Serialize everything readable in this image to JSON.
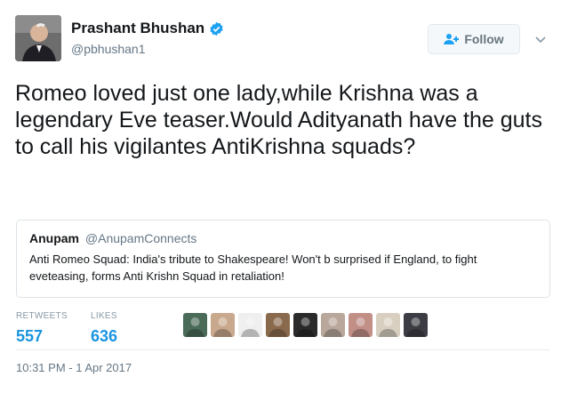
{
  "author": {
    "display_name": "Prashant Bhushan",
    "handle": "@pbhushan1",
    "verified": true,
    "avatar_icon": "user-avatar"
  },
  "follow_button": {
    "label": "Follow",
    "icon": "add-user-icon"
  },
  "tweet": {
    "text": "Romeo loved just one lady,while Krishna was a legendary Eve teaser.Would Adityanath have the guts to call his vigilantes AntiKrishna squads?"
  },
  "quoted_tweet": {
    "author_name": "Anupam",
    "author_handle": "@AnupamConnects",
    "text": "Anti Romeo Squad: India's tribute to Shakespeare! Won't b surprised if England, to fight eveteasing, forms Anti Krishn Squad in retaliation!"
  },
  "stats": {
    "retweets_label": "RETWEETS",
    "retweets_count": "557",
    "likes_label": "LIKES",
    "likes_count": "636"
  },
  "likers": [
    {
      "name": "liker-avatar-1",
      "color": "#4a6b57"
    },
    {
      "name": "liker-avatar-2",
      "color": "#c9a98e"
    },
    {
      "name": "liker-avatar-3",
      "color": "#efefef"
    },
    {
      "name": "liker-avatar-4",
      "color": "#8a6a4d"
    },
    {
      "name": "liker-avatar-5",
      "color": "#2b2b2b"
    },
    {
      "name": "liker-avatar-6",
      "color": "#b8a79a"
    },
    {
      "name": "liker-avatar-7",
      "color": "#c28f87"
    },
    {
      "name": "liker-avatar-8",
      "color": "#d9cfc0"
    },
    {
      "name": "liker-avatar-9",
      "color": "#3c3c44"
    }
  ],
  "timestamp": "10:31 PM - 1 Apr 2017",
  "colors": {
    "link_blue": "#1b95e0",
    "verified_blue": "#1da1f2",
    "muted_gray": "#657786"
  }
}
